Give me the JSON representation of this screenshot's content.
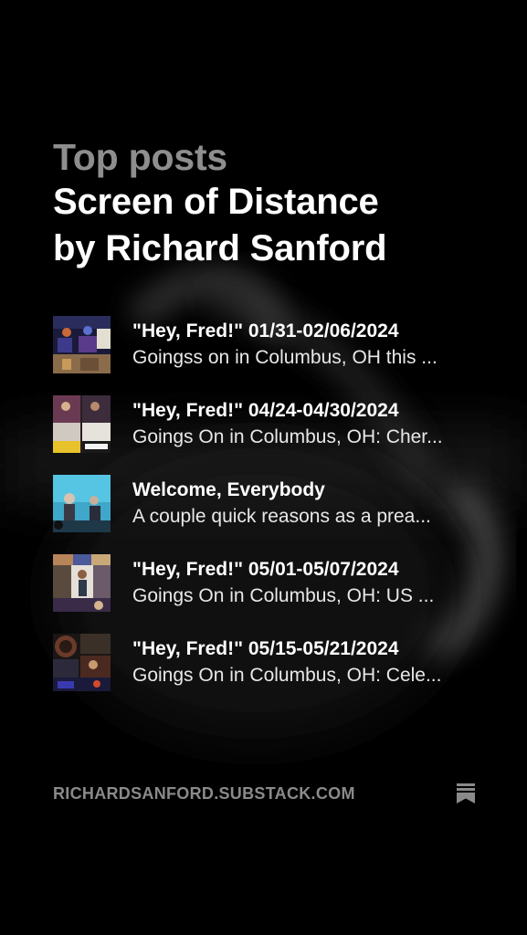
{
  "header": {
    "top_label": "Top posts",
    "title_line1": "Screen of Distance",
    "title_line2": "by Richard Sanford"
  },
  "posts": [
    {
      "title": "\"Hey, Fred!\" 01/31-02/06/2024",
      "subtitle": "Goingss on in Columbus, OH this ...",
      "thumb_icon": "concert-photo-thumbnail"
    },
    {
      "title": "\"Hey, Fred!\" 04/24-04/30/2024",
      "subtitle": "Goings On in Columbus, OH: Cher...",
      "thumb_icon": "band-collage-thumbnail"
    },
    {
      "title": "Welcome, Everybody",
      "subtitle": "A couple quick reasons as a prea...",
      "thumb_icon": "stage-performance-thumbnail"
    },
    {
      "title": "\"Hey, Fred!\" 05/01-05/07/2024",
      "subtitle": "Goings On in Columbus, OH: US ...",
      "thumb_icon": "musician-collage-thumbnail"
    },
    {
      "title": "\"Hey, Fred!\" 05/15-05/21/2024",
      "subtitle": "Goings On in Columbus, OH: Cele...",
      "thumb_icon": "event-collage-thumbnail"
    }
  ],
  "footer": {
    "url": "RICHARDSANFORD.SUBSTACK.COM",
    "icon": "substack-bookmark-icon"
  },
  "colors": {
    "background": "#000000",
    "muted_text": "#8e8e8e",
    "primary_text": "#ffffff"
  }
}
